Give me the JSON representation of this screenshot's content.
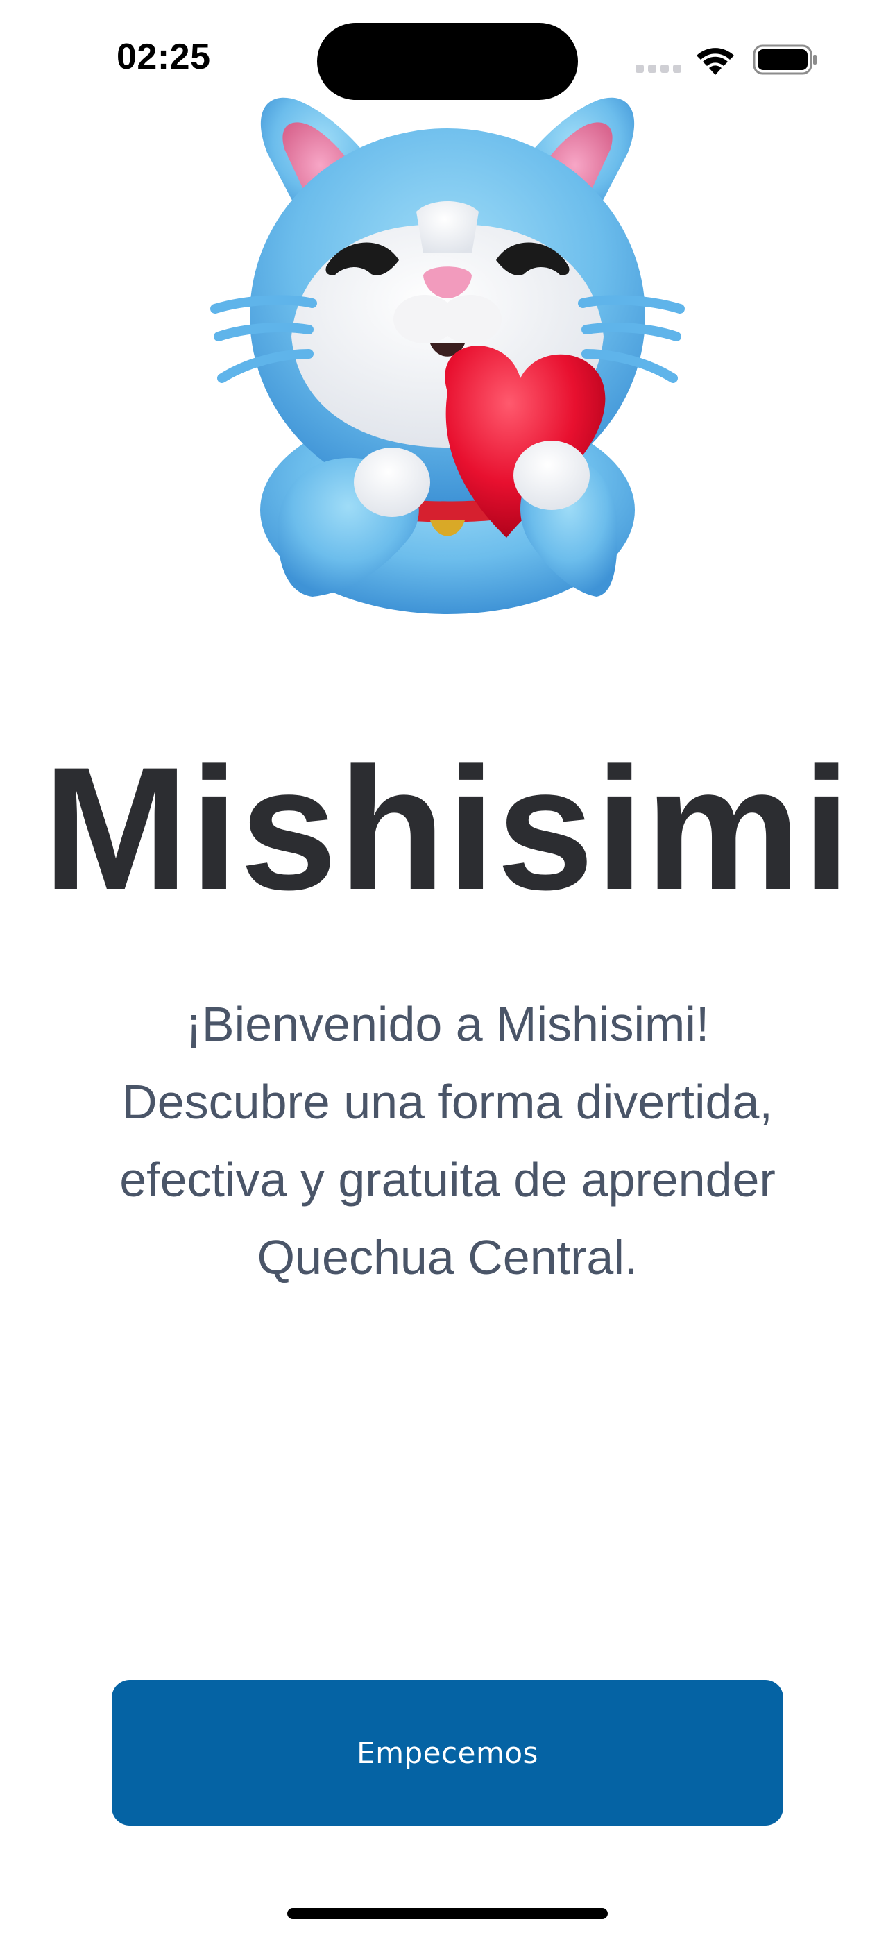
{
  "status_bar": {
    "time": "02:25",
    "icons": [
      "cellular-signal-icon",
      "wifi-icon",
      "battery-icon"
    ]
  },
  "mascot": {
    "icon": "cat-mascot-holding-heart-illustration"
  },
  "title": "Mishisimi",
  "welcome": {
    "lines": [
      "¡Bienvenido a Mishisimi!",
      "Descubre una forma divertida,",
      "efectiva y gratuita de aprender",
      "Quechua Central."
    ]
  },
  "cta": {
    "label": "Empecemos"
  },
  "colors": {
    "background": "#ffffff",
    "title": "#2c2d31",
    "body_text": "#4a5568",
    "button": "#0563a4",
    "button_text": "#ffffff"
  }
}
